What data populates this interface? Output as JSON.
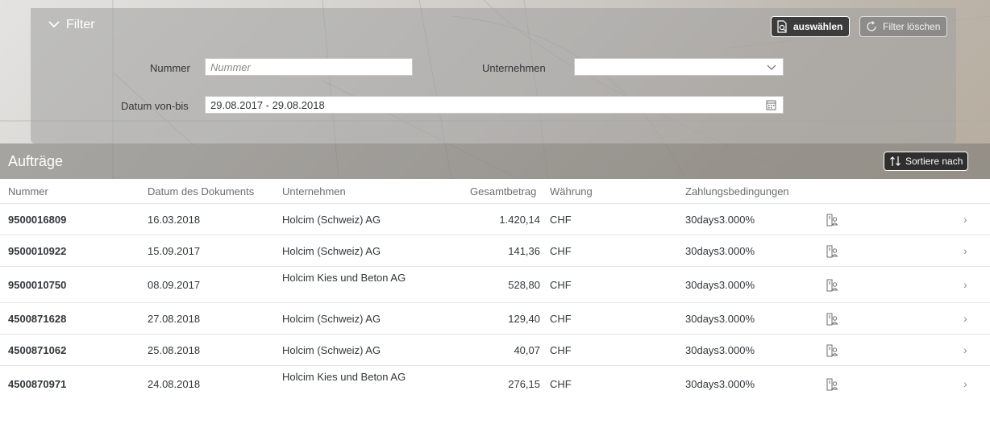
{
  "filter": {
    "title": "Filter",
    "select_button": "auswählen",
    "clear_button": "Filter löschen",
    "nummer_label": "Nummer",
    "nummer_placeholder": "Nummer",
    "unternehmen_label": "Unternehmen",
    "unternehmen_value": "",
    "date_label": "Datum von-bis",
    "date_value": "29.08.2017 - 29.08.2018"
  },
  "orders": {
    "title": "Aufträge",
    "sort_button": "Sortiere nach"
  },
  "table": {
    "headers": {
      "nummer": "Nummer",
      "datum": "Datum des Dokuments",
      "unternehmen": "Unternehmen",
      "gesamtbetrag": "Gesamtbetrag",
      "waehrung": "Währung",
      "zahlung": "Zahlungsbedingungen"
    },
    "rows": [
      {
        "nummer": "9500016809",
        "datum": "16.03.2018",
        "unternehmen": "Holcim (Schweiz) AG",
        "betrag": "1.420,14",
        "waehrung": "CHF",
        "zahlung": "30days3.000%"
      },
      {
        "nummer": "9500010922",
        "datum": "15.09.2017",
        "unternehmen": "Holcim (Schweiz) AG",
        "betrag": "141,36",
        "waehrung": "CHF",
        "zahlung": "30days3.000%"
      },
      {
        "nummer": "9500010750",
        "datum": "08.09.2017",
        "unternehmen": "Holcim Kies und Beton AG",
        "betrag": "528,80",
        "waehrung": "CHF",
        "zahlung": "30days3.000%"
      },
      {
        "nummer": "4500871628",
        "datum": "27.08.2018",
        "unternehmen": "Holcim (Schweiz) AG",
        "betrag": "129,40",
        "waehrung": "CHF",
        "zahlung": "30days3.000%"
      },
      {
        "nummer": "4500871062",
        "datum": "25.08.2018",
        "unternehmen": "Holcim (Schweiz) AG",
        "betrag": "40,07",
        "waehrung": "CHF",
        "zahlung": "30days3.000%"
      },
      {
        "nummer": "4500870971",
        "datum": "24.08.2018",
        "unternehmen": "Holcim Kies und Beton AG",
        "betrag": "276,15",
        "waehrung": "CHF",
        "zahlung": "30days3.000%"
      }
    ]
  },
  "icons": {
    "filter_toggle": "chevron-down-icon",
    "select": "document-search-icon",
    "clear": "refresh-icon",
    "calendar": "calendar-icon",
    "dropdown": "chevron-down-icon",
    "sort": "sort-icon",
    "row_document": "document-person-icon",
    "row_nav": "chevron-right-icon"
  }
}
